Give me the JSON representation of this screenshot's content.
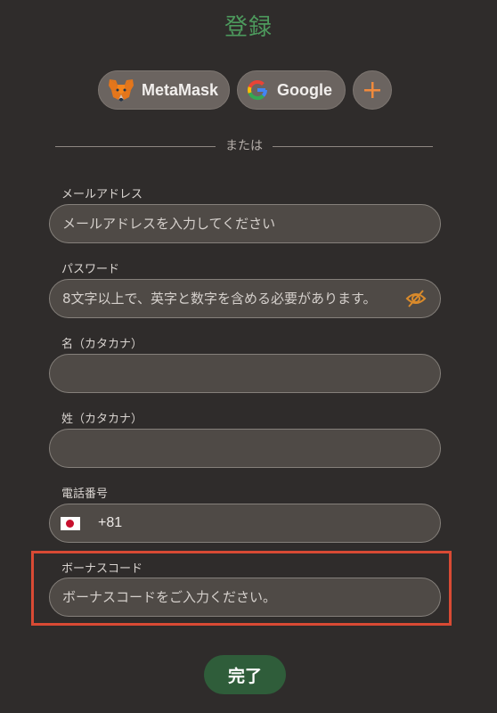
{
  "page": {
    "title": "登録",
    "accent_color": "#4d9a5d"
  },
  "auth": {
    "metamask_label": "MetaMask",
    "metamask_icon": "metamask-fox-icon",
    "google_label": "Google",
    "google_icon": "google-g-icon",
    "more_icon": "plus-icon"
  },
  "divider": {
    "text": "または"
  },
  "form": {
    "email": {
      "label": "メールアドレス",
      "placeholder": "メールアドレスを入力してください",
      "value": ""
    },
    "password": {
      "label": "パスワード",
      "placeholder": "8文字以上で、英字と数字を含める必要があります。",
      "value": "",
      "toggle_icon": "eye-slash-icon"
    },
    "first_name": {
      "label": "名（カタカナ）",
      "placeholder": "",
      "value": ""
    },
    "last_name": {
      "label": "姓（カタカナ）",
      "placeholder": "",
      "value": ""
    },
    "phone": {
      "label": "電話番号",
      "country_flag": "japan-flag-icon",
      "dial_code": "+81",
      "value": ""
    },
    "bonus_code": {
      "label": "ボーナスコード",
      "placeholder": "ボーナスコードをご入力ください。",
      "value": "",
      "highlight_color": "#d94a34"
    },
    "submit_label": "完了"
  }
}
